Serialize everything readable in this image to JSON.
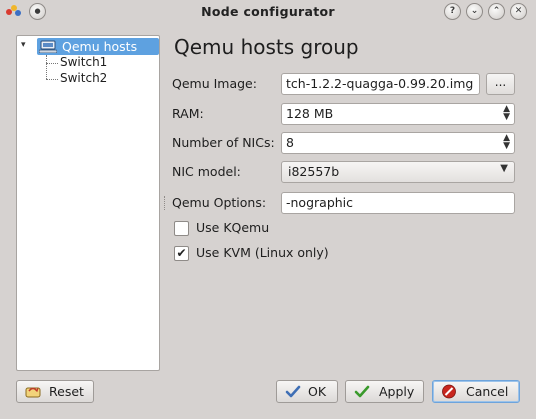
{
  "window": {
    "title": "Node configurator"
  },
  "titlebar_buttons": {
    "help": "?",
    "minimize": "⌄",
    "maximize": "⌃",
    "close": "✕"
  },
  "tree": {
    "root": "Qemu hosts",
    "children": [
      "Switch1",
      "Switch2"
    ]
  },
  "panel": {
    "title": "Qemu hosts group",
    "qemu_image": {
      "label": "Qemu Image:",
      "value": "tch-1.2.2-quagga-0.99.20.img",
      "browse": "..."
    },
    "ram": {
      "label": "RAM:",
      "value": "128 MB"
    },
    "nics": {
      "label": "Number of NICs:",
      "value": "8"
    },
    "nic_model": {
      "label": "NIC model:",
      "value": "i82557b"
    },
    "qemu_options": {
      "label": "Qemu Options:",
      "value": "-nographic"
    },
    "use_kqemu": {
      "label": "Use KQemu",
      "checked": false
    },
    "use_kvm": {
      "label": "Use KVM (Linux only)",
      "checked": true
    }
  },
  "buttons": {
    "reset": "Reset",
    "ok": "OK",
    "apply": "Apply",
    "cancel": "Cancel"
  },
  "colors": {
    "selection": "#5ea1e0",
    "window": "#d6d2d0",
    "ok_check": "#3f6fb5",
    "apply_check": "#3a9a2c",
    "cancel": "#c8261e"
  }
}
